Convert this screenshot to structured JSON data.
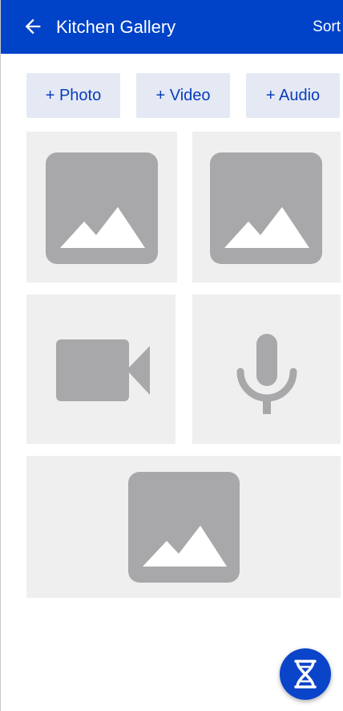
{
  "app_bar": {
    "title": "Kitchen Gallery",
    "sort_label": "Sort",
    "back_icon": "arrow-left-icon",
    "background": "#0042c8"
  },
  "add_buttons": {
    "photo_label": "+ Photo",
    "video_label": "+ Video",
    "audio_label": "+ Audio"
  },
  "gallery": {
    "items": [
      {
        "type": "photo",
        "icon": "image-placeholder-icon"
      },
      {
        "type": "photo",
        "icon": "image-placeholder-icon"
      },
      {
        "type": "video",
        "icon": "videocam-icon"
      },
      {
        "type": "audio",
        "icon": "microphone-icon"
      },
      {
        "type": "photo",
        "icon": "image-placeholder-icon"
      }
    ],
    "tile_color": "#efefef",
    "icon_color": "#a8a8aa"
  },
  "fab": {
    "icon": "dna-icon",
    "color": "#0a44c9"
  }
}
